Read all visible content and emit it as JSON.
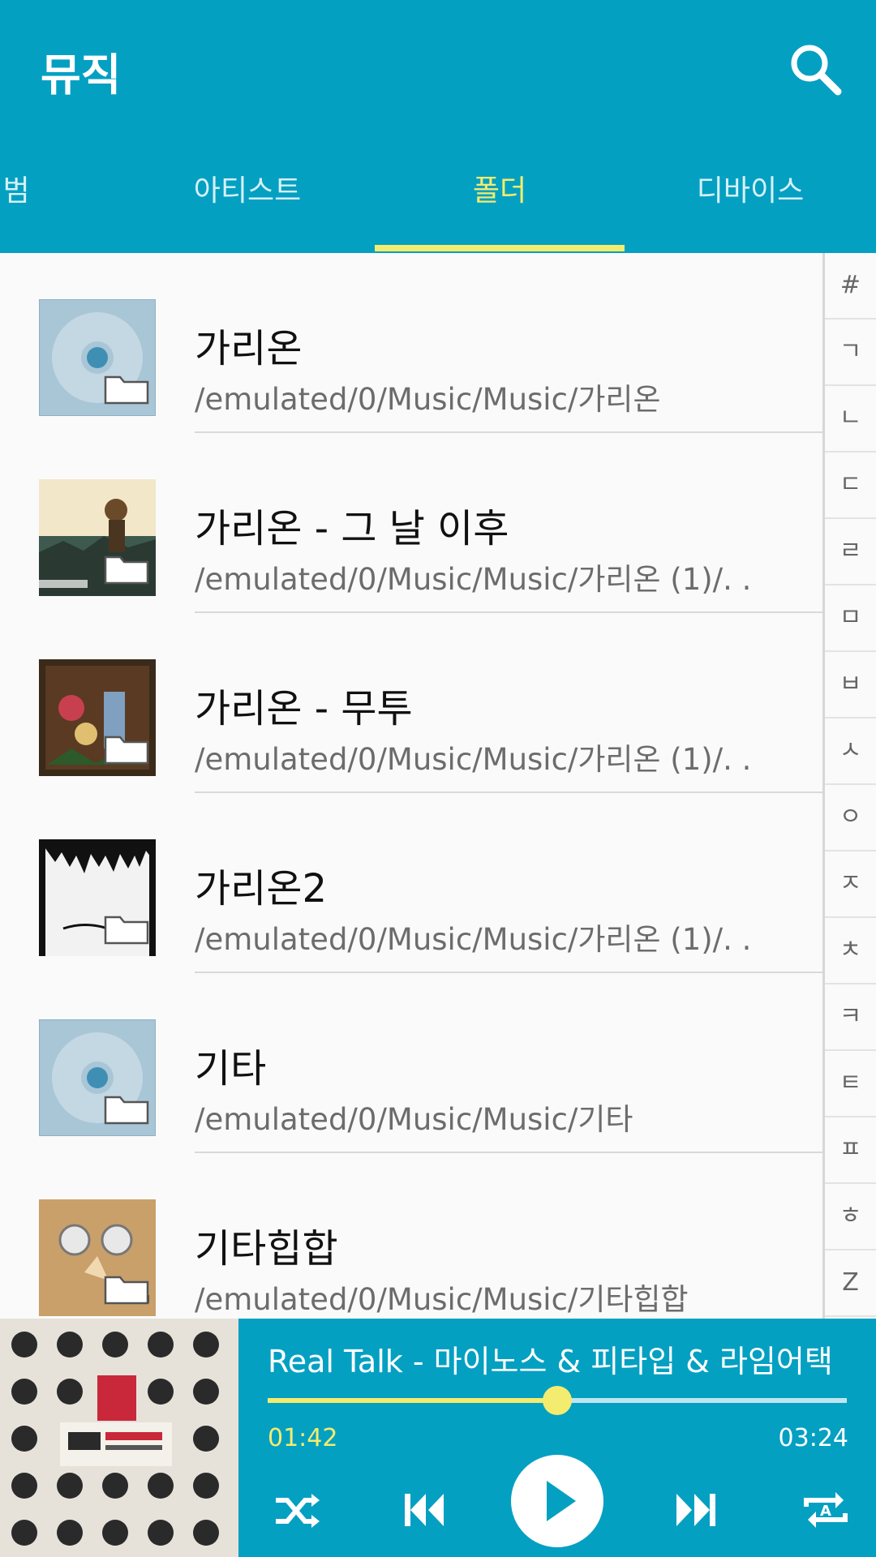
{
  "header": {
    "title": "뮤직"
  },
  "tabs": [
    {
      "label": "범"
    },
    {
      "label": "아티스트"
    },
    {
      "label": "폴더"
    },
    {
      "label": "디바이스"
    }
  ],
  "folders": [
    {
      "title": "가리온",
      "path": "/emulated/0/Music/Music/가리온"
    },
    {
      "title": "가리온 - 그 날 이후",
      "path": "/emulated/0/Music/Music/가리온 (1)/. ."
    },
    {
      "title": "가리온 - 무투",
      "path": "/emulated/0/Music/Music/가리온 (1)/. ."
    },
    {
      "title": "가리온2",
      "path": "/emulated/0/Music/Music/가리온 (1)/. ."
    },
    {
      "title": "기타",
      "path": "/emulated/0/Music/Music/기타"
    },
    {
      "title": "기타힙합",
      "path": "/emulated/0/Music/Music/기타힙합"
    }
  ],
  "index": [
    "#",
    "ㄱ",
    "ㄴ",
    "ㄷ",
    "ㄹ",
    "ㅁ",
    "ㅂ",
    "ㅅ",
    "ㅇ",
    "ㅈ",
    "ㅊ",
    "ㅋ",
    "ㅌ",
    "ㅍ",
    "ㅎ",
    "Z"
  ],
  "player": {
    "title": "Real Talk - 마이노스 & 피타입 & 라임어택",
    "elapsed": "01:42",
    "total": "03:24",
    "progress": 0.5
  },
  "colors": {
    "accent": "#04a0c2",
    "highlight": "#f4ec6e"
  }
}
